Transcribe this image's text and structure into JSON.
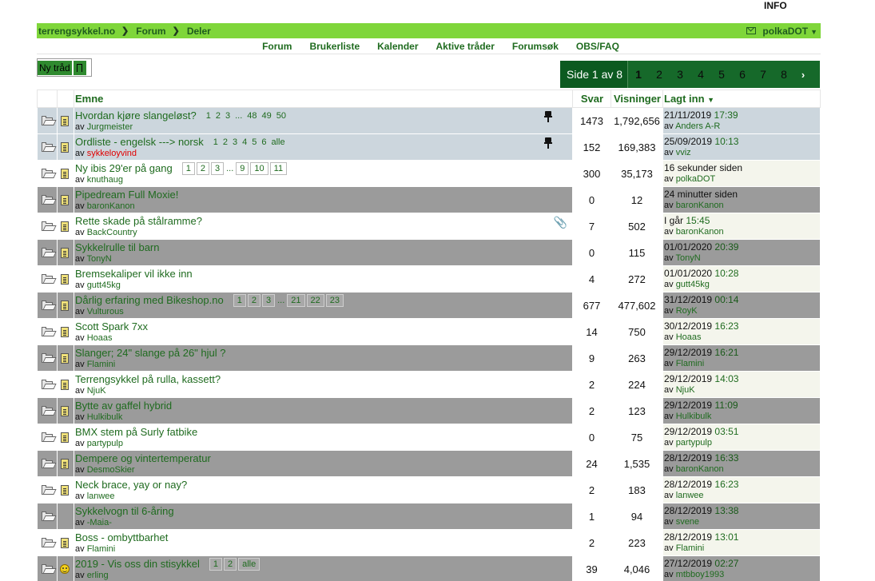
{
  "header": {
    "info": "INFO"
  },
  "breadcrumb": {
    "items": [
      "terrengsykkel.no",
      "Forum",
      "Deler"
    ]
  },
  "user": {
    "name": "polkaDOT"
  },
  "nav": {
    "items": [
      "Forum",
      "Brukerliste",
      "Kalender",
      "Aktive tråder",
      "Forumsøk",
      "OBS/FAQ"
    ]
  },
  "toolbar": {
    "new_thread": "Ny tråd"
  },
  "pagination": {
    "label": "Side 1 av 8",
    "pages": [
      "1",
      "2",
      "3",
      "4",
      "5",
      "6",
      "7",
      "8"
    ],
    "current": "1",
    "next": "›"
  },
  "table": {
    "headers": {
      "topic": "Emne",
      "replies": "Svar",
      "views": "Visninger",
      "last_post": "Lagt inn"
    },
    "rows": [
      {
        "title": "Hvordan kjøre slangeløst?",
        "pages": [
          "1",
          "2",
          "3",
          "...",
          "48",
          "49",
          "50"
        ],
        "by": "av",
        "author": "Jurgmeister",
        "replies": "1473",
        "views": "1,792,656",
        "last_date": "21/11/2019",
        "last_time": "17:39",
        "last_by": "av",
        "last_user": "Anders A-R",
        "sticky": true
      },
      {
        "title": "Ordliste - engelsk ---> norsk",
        "pages": [
          "1",
          "2",
          "3",
          "4",
          "5",
          "6",
          "alle"
        ],
        "by": "av",
        "author": "sykkeloyvind",
        "replies": "152",
        "views": "169,383",
        "last_date": "25/09/2019",
        "last_time": "10:13",
        "last_by": "av",
        "last_user": "vviz",
        "sticky": true
      },
      {
        "title": "Ny ibis 29'er på gang",
        "pages": [
          "1",
          "2",
          "3",
          "...",
          "9",
          "10",
          "11"
        ],
        "by": "av",
        "author": "knuthaug",
        "replies": "300",
        "views": "35,173",
        "last_date": "16 sekunder siden",
        "last_time": "",
        "last_by": "av",
        "last_user": "polkaDOT"
      },
      {
        "title": "Pipedream Full Moxie!",
        "pages": [],
        "by": "av",
        "author": "baronKanon",
        "replies": "0",
        "views": "12",
        "last_date": "24 minutter siden",
        "last_time": "",
        "last_by": "av",
        "last_user": "baronKanon"
      },
      {
        "title": "Rette skade på stålramme?",
        "pages": [],
        "by": "av",
        "author": "BackCountry",
        "replies": "7",
        "views": "502",
        "last_date": "I går",
        "last_time": "15:45",
        "last_by": "av",
        "last_user": "baronKanon"
      },
      {
        "title": "Sykkelrulle til barn",
        "pages": [],
        "by": "av",
        "author": "TonyN",
        "replies": "0",
        "views": "115",
        "last_date": "01/01/2020",
        "last_time": "20:39",
        "last_by": "av",
        "last_user": "TonyN"
      },
      {
        "title": "Bremsekaliper vil ikke inn",
        "pages": [],
        "by": "av",
        "author": "gutt45kg",
        "replies": "4",
        "views": "272",
        "last_date": "01/01/2020",
        "last_time": "10:28",
        "last_by": "av",
        "last_user": "gutt45kg"
      },
      {
        "title": "Dårlig erfaring med Bikeshop.no",
        "pages": [
          "1",
          "2",
          "3",
          "...",
          "21",
          "22",
          "23"
        ],
        "by": "av",
        "author": "Vulturous",
        "replies": "677",
        "views": "477,602",
        "last_date": "31/12/2019",
        "last_time": "00:14",
        "last_by": "av",
        "last_user": "RoyK"
      },
      {
        "title": "Scott Spark 7xx",
        "pages": [],
        "by": "av",
        "author": "Hoaas",
        "replies": "14",
        "views": "750",
        "last_date": "30/12/2019",
        "last_time": "16:23",
        "last_by": "av",
        "last_user": "Hoaas"
      },
      {
        "title": "Slanger; 24\" slange på 26\" hjul ?",
        "pages": [],
        "by": "av",
        "author": "Flamini",
        "replies": "9",
        "views": "263",
        "last_date": "29/12/2019",
        "last_time": "16:21",
        "last_by": "av",
        "last_user": "Flamini"
      },
      {
        "title": "Terrengsykkel på rulla, kassett?",
        "pages": [],
        "by": "av",
        "author": "NjuK",
        "replies": "2",
        "views": "224",
        "last_date": "29/12/2019",
        "last_time": "14:03",
        "last_by": "av",
        "last_user": "NjuK"
      },
      {
        "title": "Bytte av gaffel hybrid",
        "pages": [],
        "by": "av",
        "author": "Hulkibulk",
        "replies": "2",
        "views": "123",
        "last_date": "29/12/2019",
        "last_time": "11:09",
        "last_by": "av",
        "last_user": "Hulkibulk"
      },
      {
        "title": "BMX stem på Surly fatbike",
        "pages": [],
        "by": "av",
        "author": "partypulp",
        "replies": "0",
        "views": "75",
        "last_date": "29/12/2019",
        "last_time": "03:51",
        "last_by": "av",
        "last_user": "partypulp"
      },
      {
        "title": "Dempere og vintertemperatur",
        "pages": [],
        "by": "av",
        "author": "DesmoSkier",
        "replies": "24",
        "views": "1,535",
        "last_date": "28/12/2019",
        "last_time": "16:33",
        "last_by": "av",
        "last_user": "baronKanon"
      },
      {
        "title": "Neck brace, yay or nay?",
        "pages": [],
        "by": "av",
        "author": "lanwee",
        "replies": "2",
        "views": "183",
        "last_date": "28/12/2019",
        "last_time": "16:23",
        "last_by": "av",
        "last_user": "lanwee"
      },
      {
        "title": "Sykkelvogn til 6-åring",
        "pages": [],
        "by": "av",
        "author": "-Maia-",
        "replies": "1",
        "views": "94",
        "last_date": "28/12/2019",
        "last_time": "13:38",
        "last_by": "av",
        "last_user": "svene"
      },
      {
        "title": "Boss - ombyttbarhet",
        "pages": [],
        "by": "av",
        "author": "Flamini",
        "replies": "2",
        "views": "223",
        "last_date": "28/12/2019",
        "last_time": "13:01",
        "last_by": "av",
        "last_user": "Flamini"
      },
      {
        "title": "2019 - Vis oss din stisykkel",
        "pages": [
          "1",
          "2",
          "alle"
        ],
        "by": "av",
        "author": "erling",
        "replies": "39",
        "views": "4,046",
        "last_date": "27/12/2019",
        "last_time": "02:27",
        "last_by": "av",
        "last_user": "mtbboy1993"
      }
    ]
  },
  "colors": {
    "brand_green": "#7fd63a",
    "link_green": "#1f6b1f",
    "pager_green": "#16692a",
    "sticky_row": "#ccd6dd",
    "alt_row": "#9b9b9b",
    "author_red": "#e00000"
  },
  "icons": {
    "folder": "folder-icon",
    "doc": "thread-doc-icon",
    "smile": "smiley-icon",
    "pin": "pin-icon",
    "clip": "paperclip-icon",
    "envelope": "envelope-icon",
    "bookmark": "bookmark-icon"
  }
}
